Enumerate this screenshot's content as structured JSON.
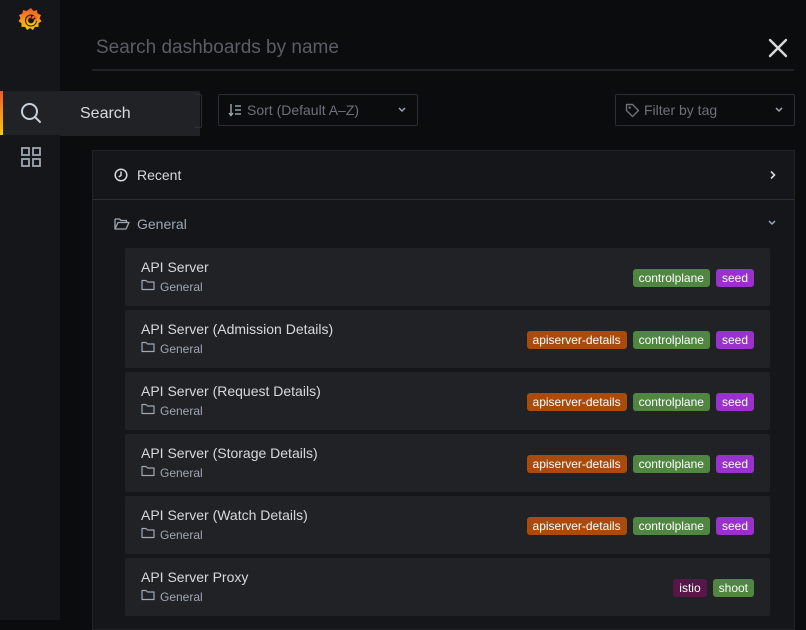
{
  "sidebar": {
    "logo": "grafana-logo",
    "search_tooltip": "Search",
    "accent_gradient": [
      "#f05a28",
      "#fbca0a"
    ]
  },
  "search": {
    "placeholder": "Search dashboards by name",
    "value": ""
  },
  "filters": {
    "sort_label": "Sort (Default A–Z)",
    "tag_placeholder": "Filter by tag"
  },
  "sections": {
    "recent": {
      "label": "Recent",
      "collapsed": true
    },
    "general": {
      "label": "General",
      "collapsed": false
    }
  },
  "tag_colors": {
    "controlplane": "#508642",
    "seed": "#9932cc",
    "apiserver-details": "#a84b0d",
    "istio": "#561748",
    "shoot": "#508642"
  },
  "dashboards": [
    {
      "title": "API Server",
      "folder": "General",
      "tags": [
        "controlplane",
        "seed"
      ]
    },
    {
      "title": "API Server (Admission Details)",
      "folder": "General",
      "tags": [
        "apiserver-details",
        "controlplane",
        "seed"
      ]
    },
    {
      "title": "API Server (Request Details)",
      "folder": "General",
      "tags": [
        "apiserver-details",
        "controlplane",
        "seed"
      ]
    },
    {
      "title": "API Server (Storage Details)",
      "folder": "General",
      "tags": [
        "apiserver-details",
        "controlplane",
        "seed"
      ]
    },
    {
      "title": "API Server (Watch Details)",
      "folder": "General",
      "tags": [
        "apiserver-details",
        "controlplane",
        "seed"
      ]
    },
    {
      "title": "API Server Proxy",
      "folder": "General",
      "tags": [
        "istio",
        "shoot"
      ]
    }
  ]
}
